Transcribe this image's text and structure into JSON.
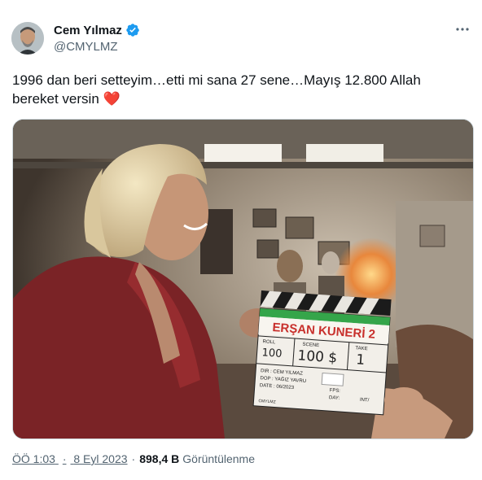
{
  "author": {
    "name": "Cem Yılmaz",
    "handle": "@CMYLMZ",
    "verified": true
  },
  "tweet": {
    "line1": "1996 dan beri setteyim…etti mi  sana 27 sene…Mayış 12.800 Allah",
    "line2": "bereket versin",
    "emoji": "❤️"
  },
  "media": {
    "clapper": {
      "title": "ERŞAN KUNERİ 2",
      "roll_label": "ROLL",
      "scene_label": "SCENE",
      "take_label": "TAKE",
      "roll": "100",
      "scene": "100 $",
      "take": "1",
      "dir": "DIR : CEM YILMAZ",
      "dop": "DOP : YAĞIZ YAVRU",
      "date": "DATE : 06/2023",
      "fps": "FPS:",
      "day": "DAY:",
      "int": "INT/",
      "brand": "CMYLMZ"
    }
  },
  "meta": {
    "time": "ÖÖ 1:03",
    "date": "8 Eyl 2023",
    "separator": "·",
    "views_count": "898,4 B",
    "views_label": "Görüntülenme"
  },
  "colors": {
    "verified_blue": "#1d9bf0",
    "heart": "#e0245e",
    "secondary_text": "#536471",
    "clapper_red": "#c8302c",
    "clapper_green": "#35a54a"
  },
  "icons": {
    "verified": "verified-badge-icon",
    "more": "more-horizontal-icon"
  }
}
